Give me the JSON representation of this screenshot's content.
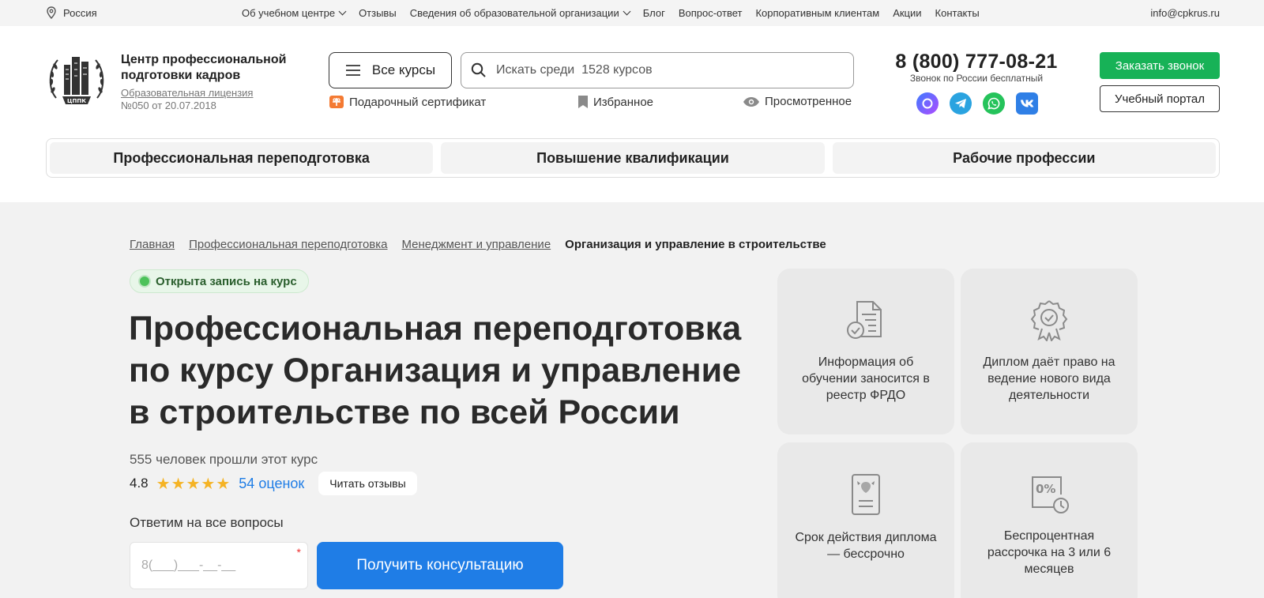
{
  "topbar": {
    "location": "Россия",
    "nav": [
      {
        "label": "Об учебном центре",
        "dropdown": true
      },
      {
        "label": "Отзывы",
        "dropdown": false
      },
      {
        "label": "Сведения об образовательной организации",
        "dropdown": true
      },
      {
        "label": "Блог",
        "dropdown": false
      },
      {
        "label": "Вопрос-ответ",
        "dropdown": false
      },
      {
        "label": "Корпоративным клиентам",
        "dropdown": false
      },
      {
        "label": "Акции",
        "dropdown": false
      },
      {
        "label": "Контакты",
        "dropdown": false
      }
    ],
    "email": "info@cpkrus.ru"
  },
  "header": {
    "logo_text": "ЦППК",
    "brand_line1": "Центр профессиональной",
    "brand_line2": "подготовки кадров",
    "license_link": "Образовательная лицензия",
    "license_number": "№050 от 20.07.2018",
    "all_courses": "Все курсы",
    "search_placeholder": "Искать среди  1528 курсов",
    "gift": "Подарочный сертификат",
    "favorites": "Избранное",
    "viewed": "Просмотренное",
    "phone": "8 (800) 777-08-21",
    "phone_note": "Звонок по России бесплатный",
    "call_button": "Заказать звонок",
    "portal_button": "Учебный портал",
    "socials": [
      {
        "name": "max",
        "color": "#7b4bf0"
      },
      {
        "name": "telegram",
        "color": "#2aa3e0"
      },
      {
        "name": "whatsapp",
        "color": "#25c35b"
      },
      {
        "name": "vk",
        "color": "#2f7fe6"
      }
    ]
  },
  "categories": [
    "Профессиональная переподготовка",
    "Повышение квалификации",
    "Рабочие профессии"
  ],
  "breadcrumbs": {
    "links": [
      "Главная",
      "Профессиональная переподготовка",
      "Менеджмент и управление"
    ],
    "current": "Организация и управление в строительстве"
  },
  "course": {
    "badge": "Открыта запись на курс",
    "title_line1": "Профессиональная переподготовка",
    "title_line2": "по курсу Организация и управление",
    "title_line3": "в строительстве по всей России",
    "passed": "555 человек прошли этот курс",
    "rating": "4.8",
    "stars": "★★★★★",
    "ratings_count": "54 оценок",
    "reviews_button": "Читать отзывы",
    "ask_label": "Ответим на все вопросы",
    "phone_placeholder": "8(___)___-__-__",
    "consult_button": "Получить консультацию"
  },
  "features": [
    {
      "icon": "document-check-icon",
      "text": "Информация об обучении заносится в реестр ФРДО"
    },
    {
      "icon": "award-badge-icon",
      "text": "Диплом даёт право на ведение нового вида деятельности"
    },
    {
      "icon": "diploma-emblem-icon",
      "text": "Срок действия диплома — бессрочно"
    },
    {
      "icon": "percent-clock-icon",
      "text": "Беспроцентная рассрочка на 3 или 6 месяцев"
    }
  ]
}
